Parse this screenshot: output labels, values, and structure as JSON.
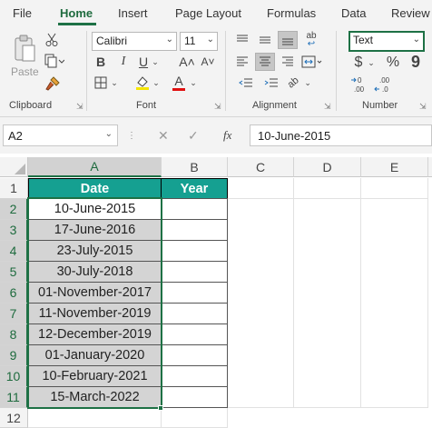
{
  "menu": {
    "tabs": [
      "File",
      "Home",
      "Insert",
      "Page Layout",
      "Formulas",
      "Data",
      "Review"
    ],
    "active": "Home"
  },
  "ribbon": {
    "clipboard": {
      "paste_label": "Paste",
      "group_label": "Clipboard"
    },
    "font": {
      "name": "Calibri",
      "size": "11",
      "group_label": "Font",
      "bold": "B",
      "italic": "I",
      "underline": "U",
      "grow": "A˄",
      "shrink": "A˅",
      "font_color_letter": "A"
    },
    "alignment": {
      "group_label": "Alignment",
      "wrap_glyph": "ab"
    },
    "number": {
      "format": "Text",
      "group_label": "Number",
      "currency": "$",
      "percent": "%",
      "comma": "9",
      "inc_decimal": "⃖.00",
      "dec_decimal": ".00"
    }
  },
  "formula_bar": {
    "name_box": "A2",
    "fx_label": "fx",
    "formula": "10-June-2015"
  },
  "sheet": {
    "columns": [
      "A",
      "B",
      "C",
      "D",
      "E"
    ],
    "rows": [
      "1",
      "2",
      "3",
      "4",
      "5",
      "6",
      "7",
      "8",
      "9",
      "10",
      "11",
      "12"
    ],
    "header_date": "Date",
    "header_year": "Year",
    "dates": [
      "10-June-2015",
      "17-June-2016",
      "23-July-2015",
      "30-July-2018",
      "01-November-2017",
      "11-November-2019",
      "12-December-2019",
      "01-January-2020",
      "10-February-2021",
      "15-March-2022"
    ],
    "colors": {
      "header_fill": "#15a091",
      "selection_fill": "#d4d4d4",
      "accent": "#1e7145"
    }
  }
}
